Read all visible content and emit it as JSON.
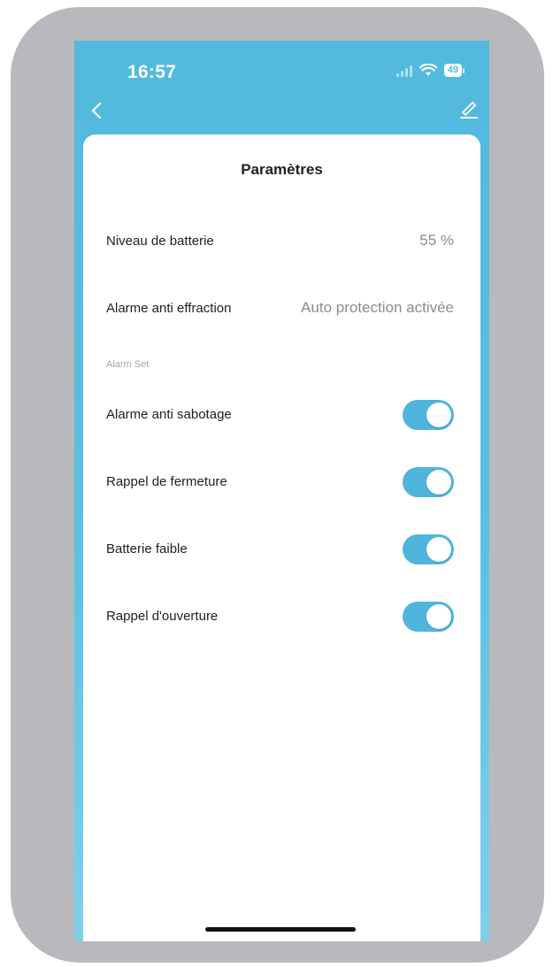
{
  "status_bar": {
    "time": "16:57",
    "battery": "49"
  },
  "header": {
    "back_icon": "chevron-left-icon",
    "edit_icon": "pencil-icon"
  },
  "card": {
    "title": "Paramètres",
    "rows": [
      {
        "label": "Niveau de batterie",
        "value": "55 %"
      },
      {
        "label": "Alarme anti effraction",
        "value": "Auto protection activée"
      }
    ],
    "section_header": "Alarm Set",
    "toggles": [
      {
        "label": "Alarme anti sabotage",
        "on": true
      },
      {
        "label": "Rappel de fermeture",
        "on": true
      },
      {
        "label": "Batterie faible",
        "on": true
      },
      {
        "label": "Rappel d'ouverture",
        "on": true
      }
    ]
  },
  "colors": {
    "accent": "#4fb5dc",
    "header_background": "#52b9de",
    "frame": "#b7b9bc"
  }
}
